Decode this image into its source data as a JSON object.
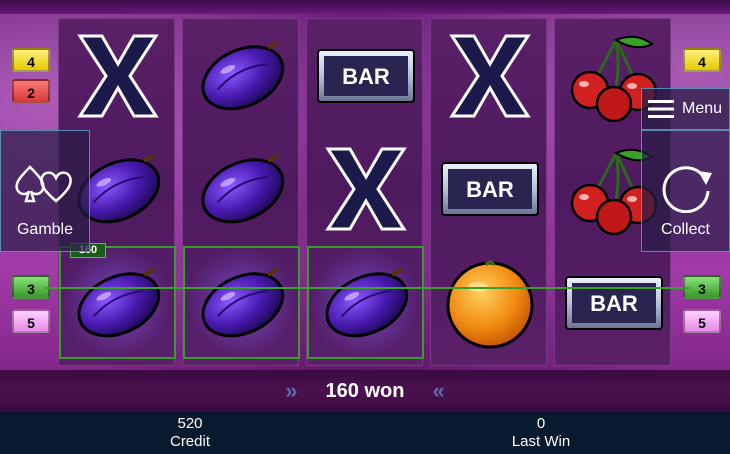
{
  "reels": [
    [
      "x",
      "plum",
      "plum"
    ],
    [
      "plum",
      "plum",
      "plum"
    ],
    [
      "bar",
      "x",
      "plum"
    ],
    [
      "x",
      "bar",
      "orange"
    ],
    [
      "cherry",
      "cherry",
      "bar"
    ]
  ],
  "winning_cells": [
    [
      0,
      2
    ],
    [
      1,
      2
    ],
    [
      2,
      2
    ]
  ],
  "bar_label": "BAR",
  "win_tag": "160",
  "left_badges": [
    "4",
    "2",
    "3",
    "5"
  ],
  "right_badges": [
    "4",
    "3",
    "5"
  ],
  "gamble_label": "Gamble",
  "collect_label": "Collect",
  "menu_label": "Menu",
  "info": {
    "left_arrows": "»",
    "right_arrows": "«",
    "won_text": "160 won"
  },
  "credit": {
    "value": "520",
    "label": "Credit"
  },
  "last_win": {
    "value": "0",
    "label": "Last Win"
  },
  "colors": {
    "payline": "#3aa02a",
    "plum": "#4a1ab0",
    "cherry": "#d02020",
    "orange": "#f08a10"
  }
}
